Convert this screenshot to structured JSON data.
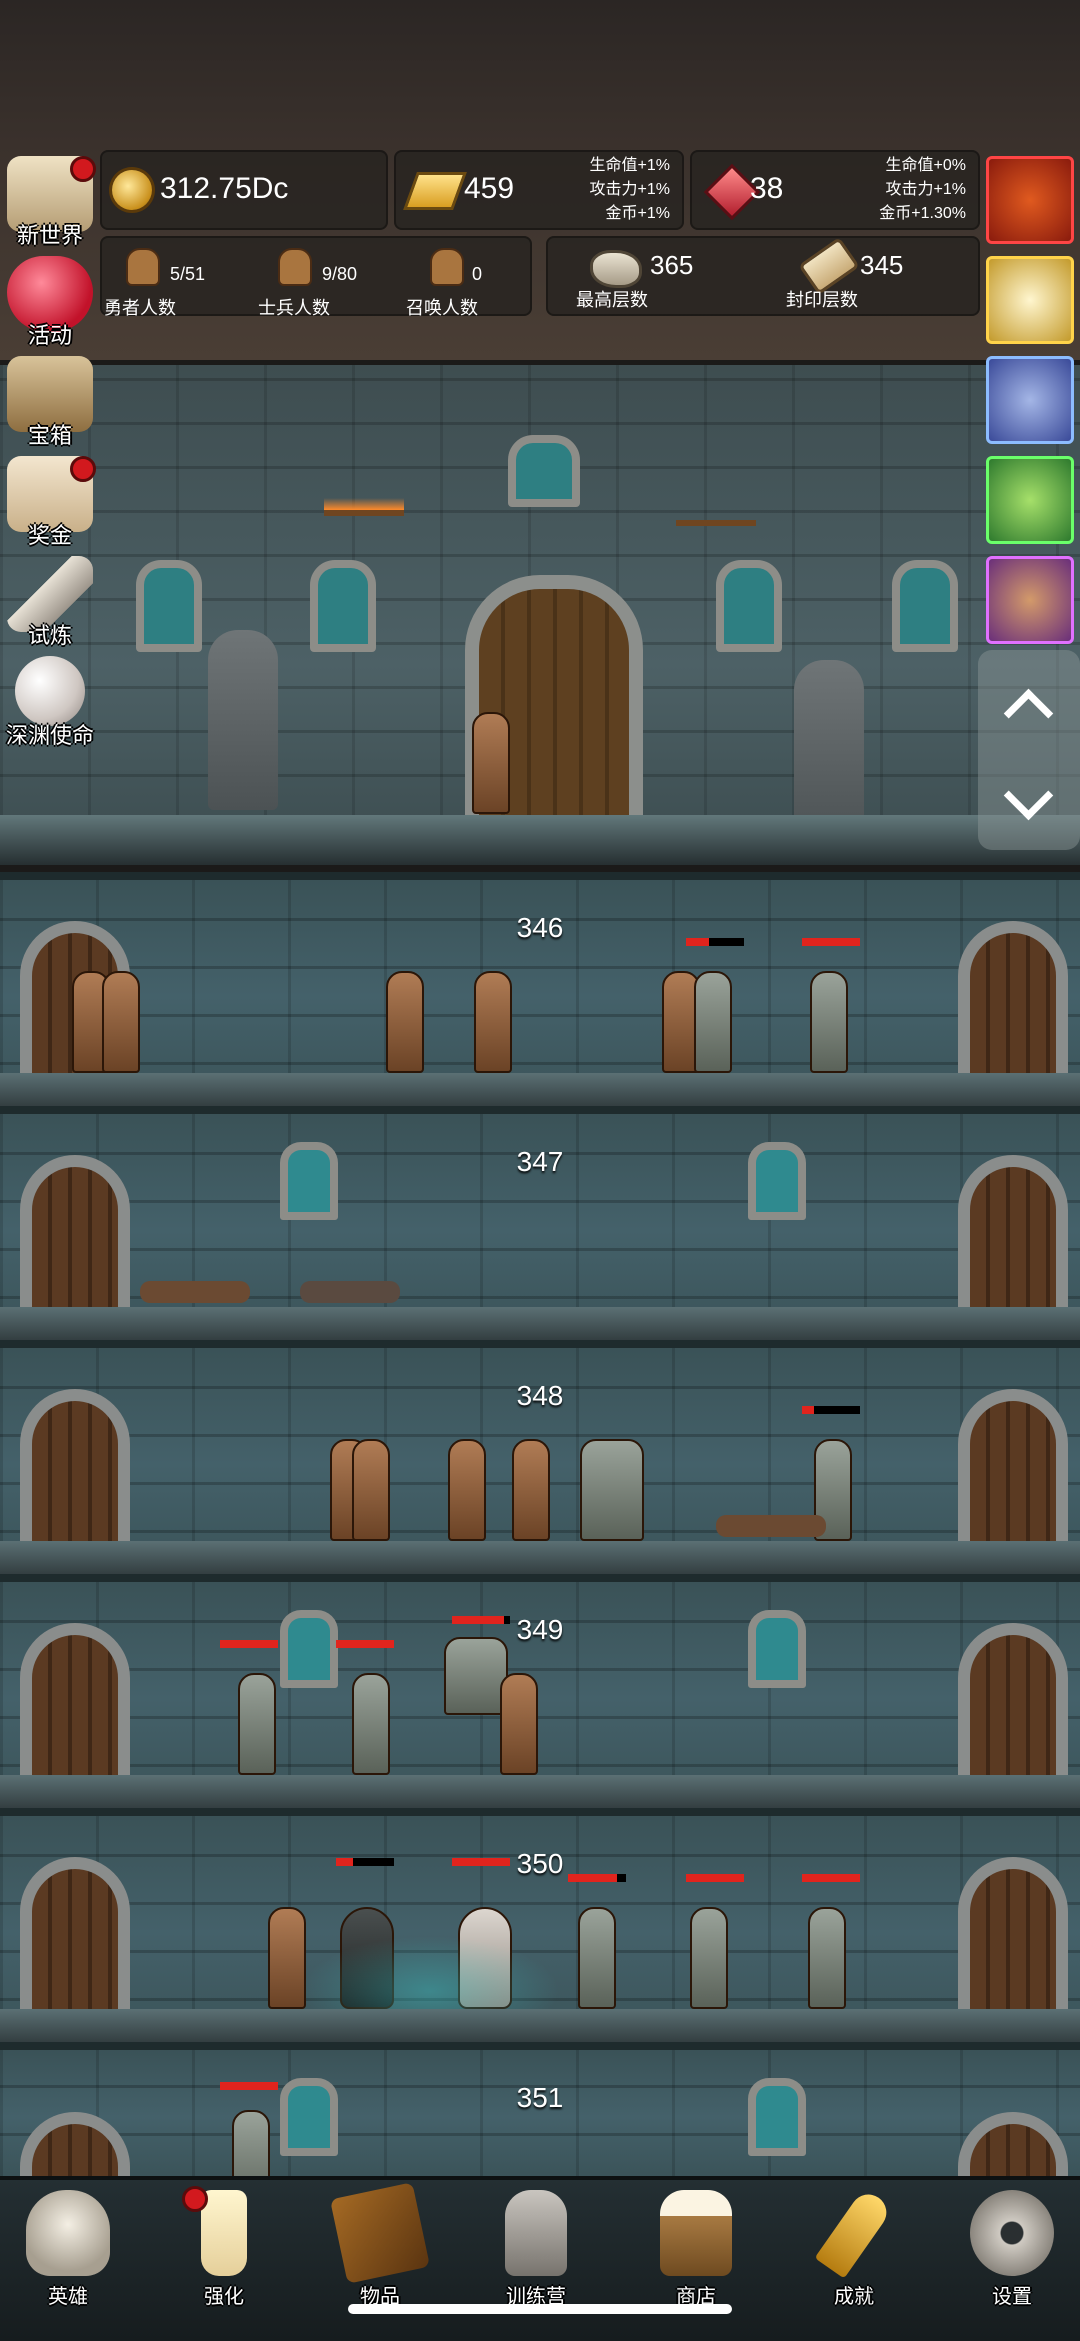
{
  "resources": {
    "gold": "312.75Dc",
    "gold_bar": "459",
    "gold_bar_bonus": [
      "生命值+1%",
      "攻击力+1%",
      "金币+1%"
    ],
    "ruby": "38",
    "ruby_bonus": [
      "生命值+0%",
      "攻击力+1%",
      "金币+1.30%"
    ]
  },
  "stats": {
    "heroes": {
      "value": "5/51",
      "label": "勇者人数"
    },
    "soldiers": {
      "value": "9/80",
      "label": "士兵人数"
    },
    "summons": {
      "value": "0",
      "label": "召唤人数"
    },
    "max_floor": {
      "value": "365",
      "label": "最高层数"
    },
    "sealed_floor": {
      "value": "345",
      "label": "封印层数"
    }
  },
  "left_menu": [
    {
      "label": "新世界",
      "icon": "map-icon",
      "dot": true
    },
    {
      "label": "活动",
      "icon": "heart-icon",
      "dot": false
    },
    {
      "label": "宝箱",
      "icon": "chest-icon",
      "dot": false
    },
    {
      "label": "奖金",
      "icon": "envelope-icon",
      "dot": true
    },
    {
      "label": "试炼",
      "icon": "feather-icon",
      "dot": false
    },
    {
      "label": "深渊使命",
      "icon": "pearl-icon",
      "dot": false
    }
  ],
  "right_slots": [
    {
      "icon": "pumpkin-icon",
      "color": "#b11c1c"
    },
    {
      "icon": "candle-icon",
      "color": "#c59a22"
    },
    {
      "icon": "cannon-icon",
      "color": "#5d67c9"
    },
    {
      "icon": "slime-icon",
      "color": "#3d9b3d"
    },
    {
      "icon": "goblin-icon",
      "color": "#a145b3"
    }
  ],
  "floors": [
    "346",
    "347",
    "348",
    "349",
    "350",
    "351"
  ],
  "bottom_nav": [
    {
      "label": "英雄",
      "icon": "skull-icon",
      "dot": false
    },
    {
      "label": "强化",
      "icon": "candle-icon",
      "dot": true
    },
    {
      "label": "物品",
      "icon": "book-icon",
      "dot": false
    },
    {
      "label": "训练营",
      "icon": "lantern-icon",
      "dot": false
    },
    {
      "label": "商店",
      "icon": "mug-icon",
      "dot": false
    },
    {
      "label": "成就",
      "icon": "key-icon",
      "dot": false
    },
    {
      "label": "设置",
      "icon": "gear-icon",
      "dot": false
    }
  ]
}
